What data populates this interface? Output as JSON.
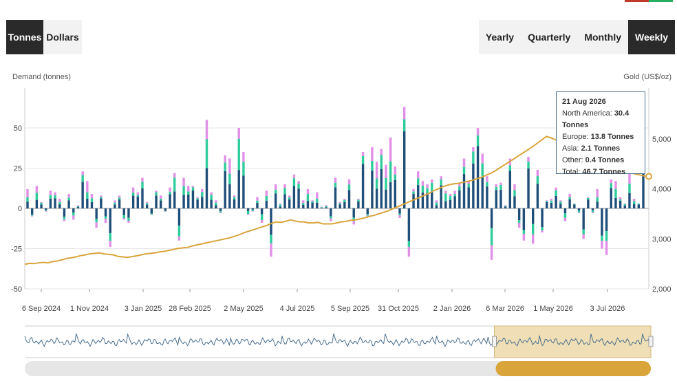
{
  "colors": {
    "north_america": "#1f4e79",
    "europe": "#2ecc9a",
    "asia": "#e28fe8",
    "other": "#9ab8d0",
    "gold": "#d9a43a",
    "accent_red": "#c0392b",
    "accent_green": "#27ae60"
  },
  "unit_toggle": {
    "tonnes_label": "Tonnes",
    "dollars_label": "Dollars",
    "selected": "Tonnes"
  },
  "period_toggle": {
    "yearly_label": "Yearly",
    "quarterly_label": "Quarterly",
    "monthly_label": "Monthly",
    "weekly_label": "Weekly",
    "selected": "Weekly"
  },
  "tooltip": {
    "date": "21 Aug 2026",
    "rows": [
      {
        "label": "North America:",
        "value": "30.4 Tonnes"
      },
      {
        "label": "Europe:",
        "value": "13.8 Tonnes"
      },
      {
        "label": "Asia:",
        "value": "2.1 Tonnes"
      },
      {
        "label": "Other:",
        "value": "0.4 Tonnes"
      },
      {
        "label": "Total:",
        "value": "46.7 Tonnes"
      }
    ]
  },
  "chart_data": {
    "type": "bar",
    "ylabel_left": "Demand (tonnes)",
    "ylabel_right": "Gold (US$/oz)",
    "ylim_left": [
      -50,
      50
    ],
    "ylim_right": [
      2000,
      5000
    ],
    "yticks_left": [
      "50",
      "25",
      "0",
      "-25",
      "-50"
    ],
    "yticks_right": [
      "5,000",
      "4,000",
      "3,000",
      "2,000"
    ],
    "xticks": [
      "6 Sep 2024",
      "1 Nov 2024",
      "3 Jan 2025",
      "28 Feb 2025",
      "2 May 2025",
      "4 Jul 2025",
      "5 Sep 2025",
      "31 Oct 2025",
      "2 Jan 2026",
      "6 Mar 2026",
      "1 May 2026",
      "3 Jul 2026"
    ],
    "grid": true,
    "stacked": true,
    "series_names": [
      "North America",
      "Europe",
      "Asia",
      "Other"
    ],
    "totals": [
      12,
      -5,
      14,
      4,
      -2,
      11,
      10,
      6,
      -8,
      9,
      -7,
      2,
      23,
      17,
      9,
      -12,
      8,
      -9,
      -24,
      5,
      8,
      -7,
      -9,
      13,
      10,
      19,
      4,
      -4,
      11,
      8,
      -2,
      13,
      22,
      -20,
      19,
      14,
      14,
      7,
      12,
      55,
      10,
      5,
      -3,
      33,
      31,
      8,
      50,
      35,
      -4,
      -2,
      7,
      -9,
      11,
      -30,
      15,
      3,
      15,
      8,
      21,
      17,
      5,
      12,
      5,
      10,
      1,
      2,
      -8,
      19,
      4,
      6,
      18,
      -10,
      6,
      35,
      -5,
      38,
      29,
      37,
      27,
      44,
      26,
      -6,
      63,
      -30,
      12,
      23,
      17,
      15,
      18,
      5,
      20,
      11,
      9,
      11,
      16,
      31,
      17,
      38,
      50,
      34,
      20,
      -32,
      15,
      16,
      2,
      31,
      15,
      -12,
      -20,
      32,
      -22,
      24,
      -15,
      5,
      6,
      13,
      5,
      -8,
      9,
      3,
      -3,
      -19,
      7,
      -3,
      12,
      -25,
      -29,
      18,
      17,
      7,
      3,
      22,
      6,
      3,
      47
    ],
    "gold_price_usd_oz": [
      2490,
      2510,
      2505,
      2520,
      2530,
      2520,
      2545,
      2560,
      2580,
      2610,
      2620,
      2640,
      2665,
      2680,
      2700,
      2710,
      2720,
      2700,
      2690,
      2680,
      2650,
      2640,
      2630,
      2645,
      2660,
      2680,
      2700,
      2710,
      2720,
      2740,
      2750,
      2770,
      2790,
      2810,
      2820,
      2830,
      2860,
      2880,
      2900,
      2920,
      2940,
      2960,
      2980,
      3000,
      3020,
      3050,
      3080,
      3120,
      3150,
      3180,
      3210,
      3240,
      3270,
      3310,
      3340,
      3330,
      3350,
      3380,
      3360,
      3340,
      3340,
      3320,
      3320,
      3330,
      3300,
      3300,
      3300,
      3320,
      3340,
      3350,
      3370,
      3380,
      3400,
      3420,
      3450,
      3470,
      3500,
      3530,
      3560,
      3600,
      3640,
      3680,
      3720,
      3760,
      3800,
      3840,
      3880,
      3920,
      3970,
      4010,
      4050,
      4080,
      4100,
      4110,
      4130,
      4150,
      4170,
      4200,
      4230,
      4270,
      4310,
      4360,
      4420,
      4480,
      4540,
      4600,
      4660,
      4720,
      4780,
      4840,
      4910,
      4980,
      5050,
      5020,
      4980,
      4940,
      4900,
      4860,
      4820,
      4780,
      4740,
      4700,
      4660,
      4620,
      4580,
      4540,
      4500,
      4460,
      4420,
      4380,
      4340,
      4300,
      4280,
      4260,
      4250
    ]
  },
  "navigator": {
    "range_start_fraction": 0.75,
    "range_end_fraction": 1.0
  }
}
